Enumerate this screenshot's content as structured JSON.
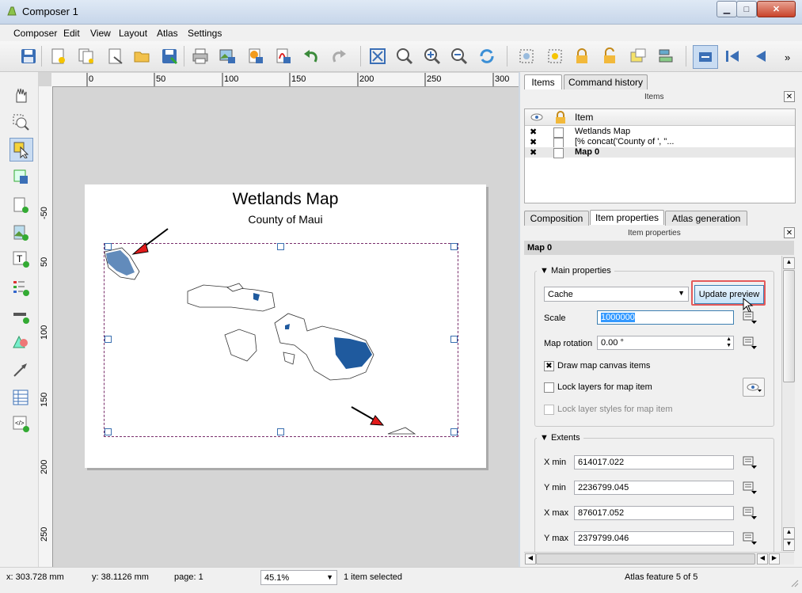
{
  "window": {
    "title": "Composer 1",
    "min_glyph": "▁",
    "max_glyph": "□",
    "close_glyph": "✕"
  },
  "menu": [
    "Composer",
    "Edit",
    "View",
    "Layout",
    "Atlas",
    "Settings"
  ],
  "toolbar": {
    "overflow": "»"
  },
  "ruler": {
    "h": [
      "0",
      "50",
      "100",
      "150",
      "200",
      "250",
      "300"
    ],
    "v": [
      "50",
      "100",
      "150",
      "200",
      "250",
      "-50"
    ]
  },
  "map": {
    "title": "Wetlands Map",
    "subtitle": "County of Maui"
  },
  "dock": {
    "tabs": [
      "Items",
      "Command history"
    ],
    "items_panel_title": "Items",
    "items_header": "Item",
    "items": [
      {
        "label": "Wetlands Map",
        "bold": false
      },
      {
        "label": "[% concat('County of ', \"...",
        "bold": false
      },
      {
        "label": "Map 0",
        "bold": true
      }
    ],
    "prop_tabs": [
      "Composition",
      "Item properties",
      "Atlas generation"
    ],
    "props_panel_title": "Item properties",
    "selected_item": "Map 0",
    "main_props_label": "Main properties",
    "cache_value": "Cache",
    "update_preview": "Update preview",
    "scale_label": "Scale",
    "scale_value": "1000000",
    "rotation_label": "Map rotation",
    "rotation_value": "0.00 °",
    "draw_canvas_items": "Draw map canvas items",
    "lock_layers": "Lock layers for map item",
    "lock_styles": "Lock layer styles for map item",
    "extents_label": "Extents",
    "xmin_label": "X min",
    "xmin": "614017.022",
    "ymin_label": "Y min",
    "ymin": "2236799.045",
    "xmax_label": "X max",
    "xmax": "876017.052",
    "ymax_label": "Y max",
    "ymax": "2379799.046"
  },
  "status": {
    "x": "x: 303.728 mm",
    "y": "y: 38.1126 mm",
    "page": "page: 1",
    "zoom": "45.1%",
    "selected": "1 item selected",
    "atlas": "Atlas feature 5 of 5"
  },
  "colors": {
    "accent": "#3a6fb0",
    "wetland": "#1f5a9e",
    "highlight": "#e45a5a",
    "arrow": "#e21b1b"
  }
}
